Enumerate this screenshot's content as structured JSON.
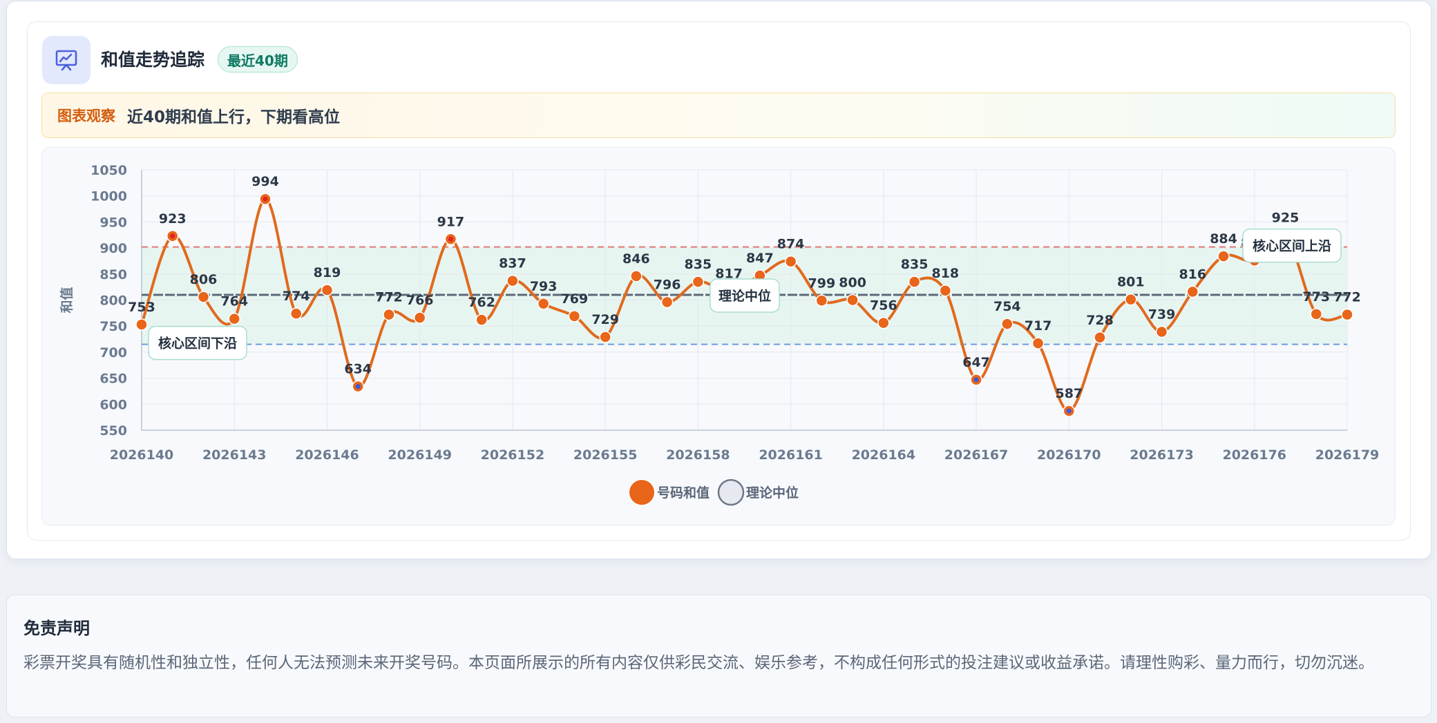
{
  "header": {
    "title": "和值走势追踪",
    "badge": "最近40期",
    "icon": "chart-presentation-icon"
  },
  "insight": {
    "label": "图表观察",
    "text": "近40期和值上行，下期看高位"
  },
  "colors": {
    "series_line": "#e06a1e",
    "point_fill": "#e8651a",
    "peak_dot": "#e02424",
    "trough_dot": "#3b5bd9",
    "upper_band": "#e07a72",
    "lower_band": "#6d9be0",
    "median_line": "#5d6878",
    "band_fill": "#e4f4ef",
    "accent_teal": "#0f7a63",
    "accent_orange": "#d35d0e"
  },
  "chart_data": {
    "type": "line",
    "ylabel": "和值",
    "xlabel": "",
    "ylim": [
      550,
      1050
    ],
    "yticks": [
      550,
      600,
      650,
      700,
      750,
      800,
      850,
      900,
      950,
      1000,
      1050
    ],
    "xtick_labels": [
      "2026140",
      "2026143",
      "2026146",
      "2026149",
      "2026152",
      "2026155",
      "2026158",
      "2026161",
      "2026164",
      "2026167",
      "2026170",
      "2026173",
      "2026176",
      "2026179"
    ],
    "grid": true,
    "series": [
      {
        "name": "号码和值",
        "x": [
          2026140,
          2026141,
          2026142,
          2026143,
          2026144,
          2026145,
          2026146,
          2026147,
          2026148,
          2026149,
          2026150,
          2026151,
          2026152,
          2026153,
          2026154,
          2026155,
          2026156,
          2026157,
          2026158,
          2026159,
          2026160,
          2026161,
          2026162,
          2026163,
          2026164,
          2026165,
          2026166,
          2026167,
          2026168,
          2026169,
          2026170,
          2026171,
          2026172,
          2026173,
          2026174,
          2026175,
          2026176,
          2026177,
          2026178,
          2026179
        ],
        "values": [
          753,
          923,
          806,
          764,
          994,
          774,
          819,
          634,
          772,
          766,
          917,
          762,
          837,
          793,
          769,
          729,
          846,
          796,
          835,
          817,
          847,
          874,
          799,
          800,
          756,
          835,
          818,
          647,
          754,
          717,
          587,
          728,
          801,
          739,
          816,
          884,
          876,
          925,
          773,
          772
        ]
      }
    ],
    "reference_lines": [
      {
        "name": "理论中位",
        "value": 810
      },
      {
        "name": "核心区间上沿",
        "value": 902
      },
      {
        "name": "核心区间下沿",
        "value": 715
      }
    ],
    "highlight_peaks": [
      923,
      994,
      917,
      925
    ],
    "highlight_troughs": [
      634,
      647,
      587
    ],
    "legend": [
      {
        "name": "号码和值"
      },
      {
        "name": "理论中位"
      }
    ],
    "legend_position": "bottom-center"
  },
  "disclaimer": {
    "title": "免责声明",
    "text": "彩票开奖具有随机性和独立性，任何人无法预测未来开奖号码。本页面所展示的所有内容仅供彩民交流、娱乐参考，不构成任何形式的投注建议或收益承诺。请理性购彩、量力而行，切勿沉迷。"
  }
}
